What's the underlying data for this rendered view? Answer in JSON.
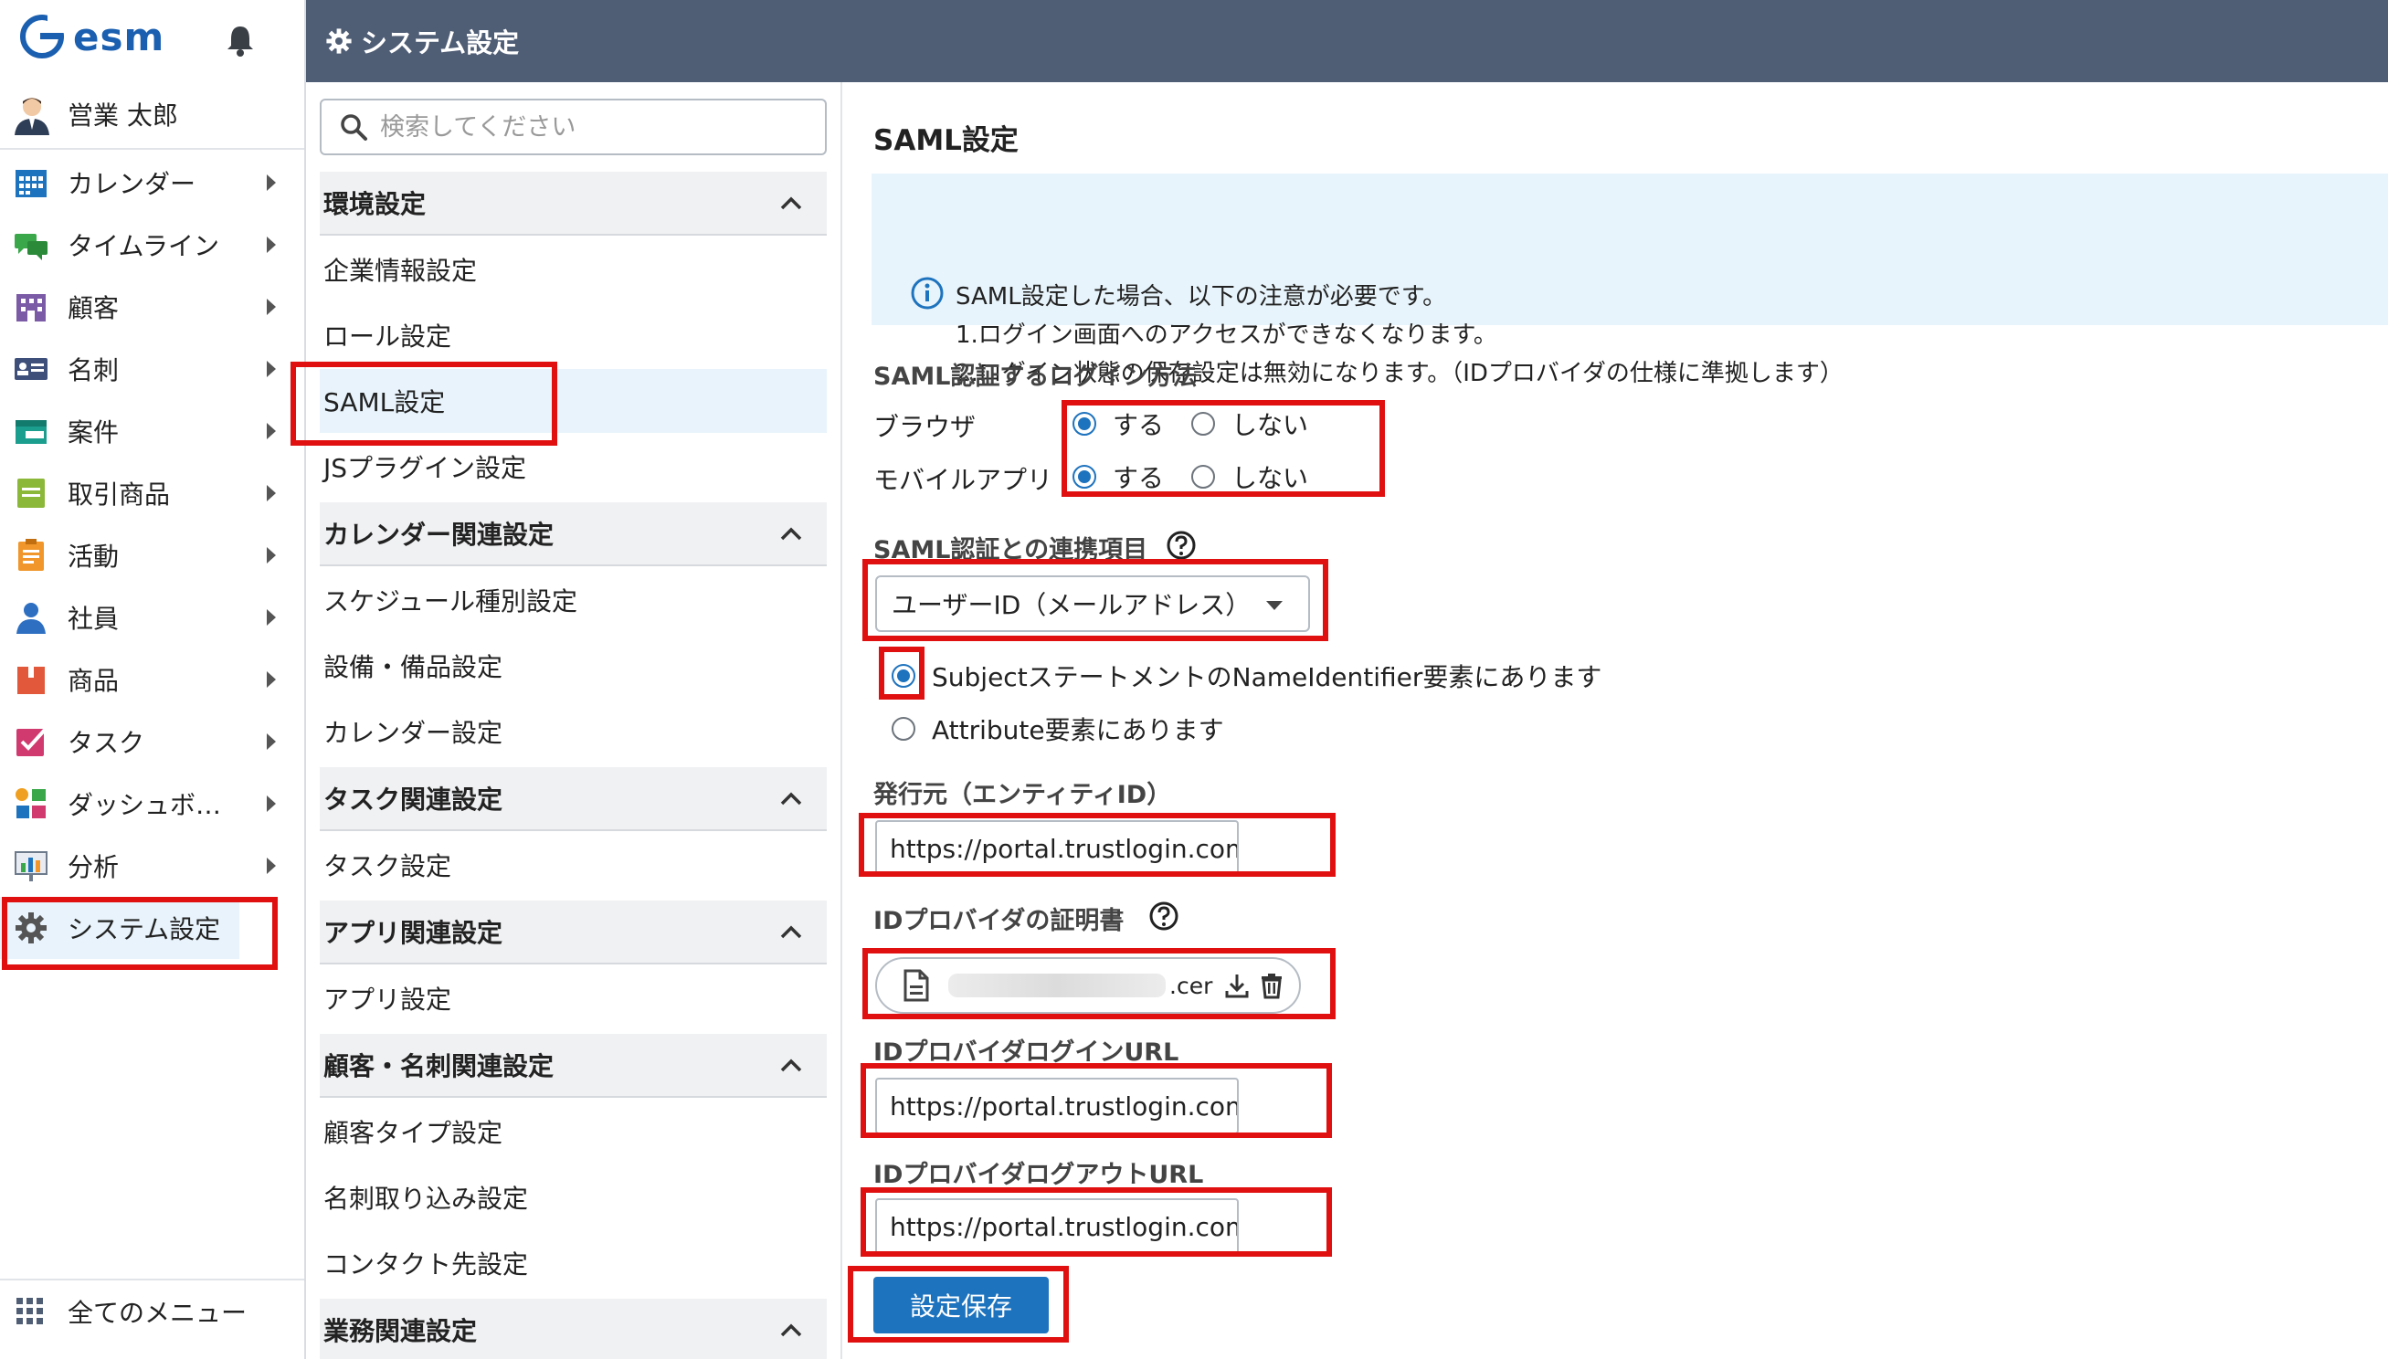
{
  "app": {
    "logo_text": "esm"
  },
  "user": {
    "name": "営業 太郎"
  },
  "sidebar": {
    "items": [
      {
        "label": "カレンダー",
        "icon": "calendar-icon"
      },
      {
        "label": "タイムライン",
        "icon": "chat-icon"
      },
      {
        "label": "顧客",
        "icon": "building-icon"
      },
      {
        "label": "名刺",
        "icon": "business-card-icon"
      },
      {
        "label": "案件",
        "icon": "folder-icon"
      },
      {
        "label": "取引商品",
        "icon": "note-icon"
      },
      {
        "label": "活動",
        "icon": "clipboard-icon"
      },
      {
        "label": "社員",
        "icon": "person-icon"
      },
      {
        "label": "商品",
        "icon": "box-icon"
      },
      {
        "label": "タスク",
        "icon": "checkbox-icon"
      },
      {
        "label": "ダッシュボ…",
        "icon": "dashboard-icon"
      },
      {
        "label": "分析",
        "icon": "chart-icon"
      },
      {
        "label": "システム設定",
        "icon": "gear-icon"
      }
    ],
    "all_menu": "全てのメニュー"
  },
  "header": {
    "title": "システム設定"
  },
  "menu": {
    "search_placeholder": "検索してください",
    "sections": {
      "env": "環境設定",
      "calendar": "カレンダー関連設定",
      "task": "タスク関連設定",
      "app": "アプリ関連設定",
      "customer": "顧客・名刺関連設定",
      "business": "業務関連設定"
    },
    "items": {
      "company": "企業情報設定",
      "role": "ロール設定",
      "saml": "SAML設定",
      "js": "JSプラグイン設定",
      "schedule_type": "スケジュール種別設定",
      "equipment": "設備・備品設定",
      "calendar": "カレンダー設定",
      "task": "タスク設定",
      "app": "アプリ設定",
      "customer_type": "顧客タイプ設定",
      "card_import": "名刺取り込み設定",
      "contact": "コンタクト先設定"
    }
  },
  "content": {
    "title": "SAML設定",
    "notice": {
      "line1": "SAML設定した場合、以下の注意が必要です。",
      "line2": "1.ログイン画面へのアクセスができなくなります。",
      "line3": "2.ログイン状態の保存設定は無効になります。（IDプロバイダの仕様に準拠します）"
    },
    "login_method": {
      "label": "SAML認証するログイン方法",
      "browser": "ブラウザ",
      "mobile": "モバイルアプリ",
      "yes": "する",
      "no": "しない"
    },
    "link_item": {
      "label": "SAML認証との連携項目",
      "selected": "ユーザーID（メールアドレス）",
      "option_subject": "SubjectステートメントのNameIdentifier要素にあります",
      "option_attribute": "Attribute要素にあります"
    },
    "issuer": {
      "label": "発行元（エンティティID）",
      "value": "https://portal.trustlogin.com/"
    },
    "certificate": {
      "label": "IDプロバイダの証明書",
      "ext": ".cer"
    },
    "login_url": {
      "label": "IDプロバイダログインURL",
      "value": "https://portal.trustlogin.com/"
    },
    "logout_url": {
      "label": "IDプロバイダログアウトURL",
      "value": "https://portal.trustlogin.com/"
    },
    "save_label": "設定保存"
  },
  "colors": {
    "header_bg": "#4f5d75",
    "accent": "#1e73be",
    "annotation": "#e01010",
    "notice_bg": "#e8f4fb"
  }
}
